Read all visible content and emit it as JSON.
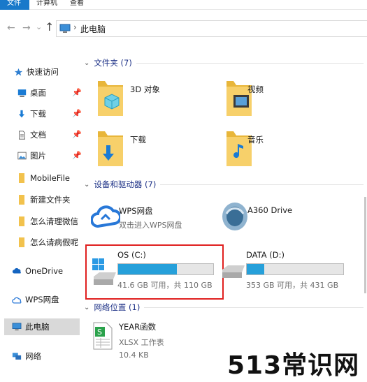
{
  "ribbon": {
    "tabs": [
      "文件",
      "计算机",
      "查看"
    ]
  },
  "address": {
    "back": "←",
    "forward": "→",
    "recent": "⌄",
    "up": "↑",
    "separator": "›",
    "path": "此电脑"
  },
  "sidebar": {
    "items": [
      {
        "label": "快速访问",
        "icon": "star-icon",
        "pinned": false
      },
      {
        "label": "桌面",
        "icon": "desktop-icon",
        "pinned": true
      },
      {
        "label": "下载",
        "icon": "download-icon",
        "pinned": true
      },
      {
        "label": "文档",
        "icon": "document-icon",
        "pinned": true
      },
      {
        "label": "图片",
        "icon": "pictures-icon",
        "pinned": true
      },
      {
        "label": "MobileFile",
        "icon": "folder-icon",
        "pinned": false
      },
      {
        "label": "新建文件夹",
        "icon": "folder-icon",
        "pinned": false
      },
      {
        "label": "怎么清理微信",
        "icon": "folder-icon",
        "pinned": false
      },
      {
        "label": "怎么请病假呢",
        "icon": "folder-icon",
        "pinned": false
      },
      {
        "label": "OneDrive",
        "icon": "cloud-icon",
        "pinned": false
      },
      {
        "label": "WPS网盘",
        "icon": "wps-cloud-icon",
        "pinned": false
      },
      {
        "label": "此电脑",
        "icon": "computer-icon",
        "pinned": false,
        "selected": true
      },
      {
        "label": "网络",
        "icon": "network-icon",
        "pinned": false
      }
    ],
    "pin_glyph": "📌"
  },
  "groups": {
    "folders": {
      "title": "文件夹 (7)",
      "chevron": "⌄"
    },
    "devices": {
      "title": "设备和驱动器 (7)",
      "chevron": "⌄"
    },
    "network": {
      "title": "网络位置 (1)",
      "chevron": "⌄"
    }
  },
  "folders": [
    {
      "label": "3D 对象",
      "icon": "3d-objects-folder-icon"
    },
    {
      "label": "视频",
      "icon": "videos-folder-icon"
    },
    {
      "label": "下载",
      "icon": "downloads-folder-icon"
    },
    {
      "label": "音乐",
      "icon": "music-folder-icon"
    }
  ],
  "devices": [
    {
      "label": "WPS网盘",
      "sub": "双击进入WPS网盘",
      "icon": "wps-cloud-icon"
    },
    {
      "label": "A360 Drive",
      "sub": "",
      "icon": "a360-drive-icon"
    },
    {
      "label": "OS (C:)",
      "sub": "41.6 GB 可用，共 110 GB",
      "icon": "windows-drive-icon",
      "used_fraction": 0.62,
      "selected": true
    },
    {
      "label": "DATA (D:)",
      "sub": "353 GB 可用，共 431 GB",
      "icon": "hard-drive-icon",
      "used_fraction": 0.18
    }
  ],
  "network_items": [
    {
      "label": "YEAR函数",
      "type": "XLSX 工作表",
      "size": "10.4 KB",
      "icon": "xlsx-file-icon"
    }
  ],
  "watermark": "513常识网",
  "colors": {
    "accent": "#26a0da",
    "selection_border": "#e0201f",
    "group_title": "#1e3287",
    "folder": "#f2c24d"
  }
}
